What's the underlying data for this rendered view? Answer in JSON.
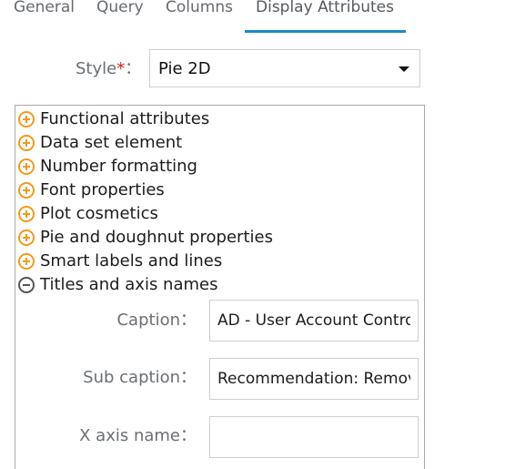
{
  "tabs": [
    {
      "label": "General"
    },
    {
      "label": "Query"
    },
    {
      "label": "Columns"
    },
    {
      "label": "Display Attributes",
      "active": true
    }
  ],
  "style_field": {
    "label": "Style",
    "required_mark": "*",
    "colon": "：",
    "value": "Pie 2D"
  },
  "tree": [
    {
      "label": "Functional attributes",
      "expanded": false
    },
    {
      "label": "Data set element",
      "expanded": false
    },
    {
      "label": "Number formatting",
      "expanded": false
    },
    {
      "label": "Font properties",
      "expanded": false
    },
    {
      "label": "Plot cosmetics",
      "expanded": false
    },
    {
      "label": "Pie and doughnut properties",
      "expanded": false
    },
    {
      "label": "Smart labels and lines",
      "expanded": false
    },
    {
      "label": "Titles and axis names",
      "expanded": true
    }
  ],
  "fields": {
    "caption": {
      "label": "Caption：",
      "value": "AD - User Account Control Issues"
    },
    "sub_caption": {
      "label": "Sub caption：",
      "value": "Recommendation: Remove"
    },
    "x_axis_name": {
      "label": "X axis name：",
      "value": ""
    }
  },
  "colors": {
    "accent": "#1a8ac6",
    "expand_icon": "#f39a1c",
    "required": "#cc1f1f"
  }
}
